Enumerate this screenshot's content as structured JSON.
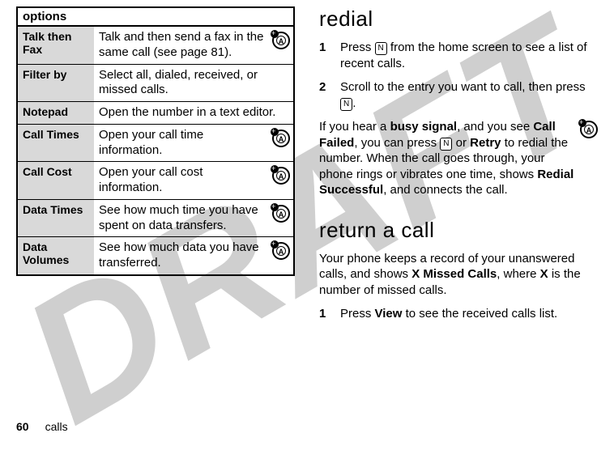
{
  "watermark": "DRAFT",
  "table": {
    "header": "options",
    "rows": [
      {
        "label": "Talk then Fax",
        "desc": "Talk and then send a fax in the same call (see page 81).",
        "icon": true
      },
      {
        "label": "Filter by",
        "desc": "Select all, dialed, received, or missed calls.",
        "icon": false
      },
      {
        "label": "Notepad",
        "desc": "Open the number in a text editor.",
        "icon": false
      },
      {
        "label": "Call Times",
        "desc": "Open your call time information.",
        "icon": true
      },
      {
        "label": "Call Cost",
        "desc": "Open your call cost information.",
        "icon": true
      },
      {
        "label": "Data Times",
        "desc": "See how much time you have spent on data transfers.",
        "icon": true
      },
      {
        "label": "Data Volumes",
        "desc": "See how much data you have transferred.",
        "icon": true
      }
    ]
  },
  "right": {
    "h_redial": "redial",
    "redial_steps": [
      {
        "num": "1",
        "pre": "Press ",
        "key": "N",
        "post": " from the home screen to see a list of recent calls."
      },
      {
        "num": "2",
        "pre": "Scroll to the entry you want to call, then press ",
        "key": "N",
        "post": "."
      }
    ],
    "busy_para_1a": "If you hear a ",
    "busy_bold1": "busy signal",
    "busy_para_1b": ", and you see ",
    "busy_bold2": "Call Failed",
    "busy_para_1c": ", you can press ",
    "busy_key": "N",
    "busy_para_1d": " or ",
    "busy_bold3": "Retry",
    "busy_para_1e": " to redial the number. When the call goes through, your phone rings or vibrates one time, shows ",
    "busy_bold4": "Redial Successful",
    "busy_para_1f": ", and connects the call.",
    "h_return": "return a call",
    "return_para_a": "Your phone keeps a record of your unanswered calls, and shows ",
    "return_bold1": "X Missed Calls",
    "return_para_b": ", where ",
    "return_bold2": "X",
    "return_para_c": " is the number of missed calls.",
    "return_step_num": "1",
    "return_step_a": "Press ",
    "return_step_bold": "View",
    "return_step_b": " to see the received calls list."
  },
  "footer": {
    "page": "60",
    "label": "calls"
  }
}
